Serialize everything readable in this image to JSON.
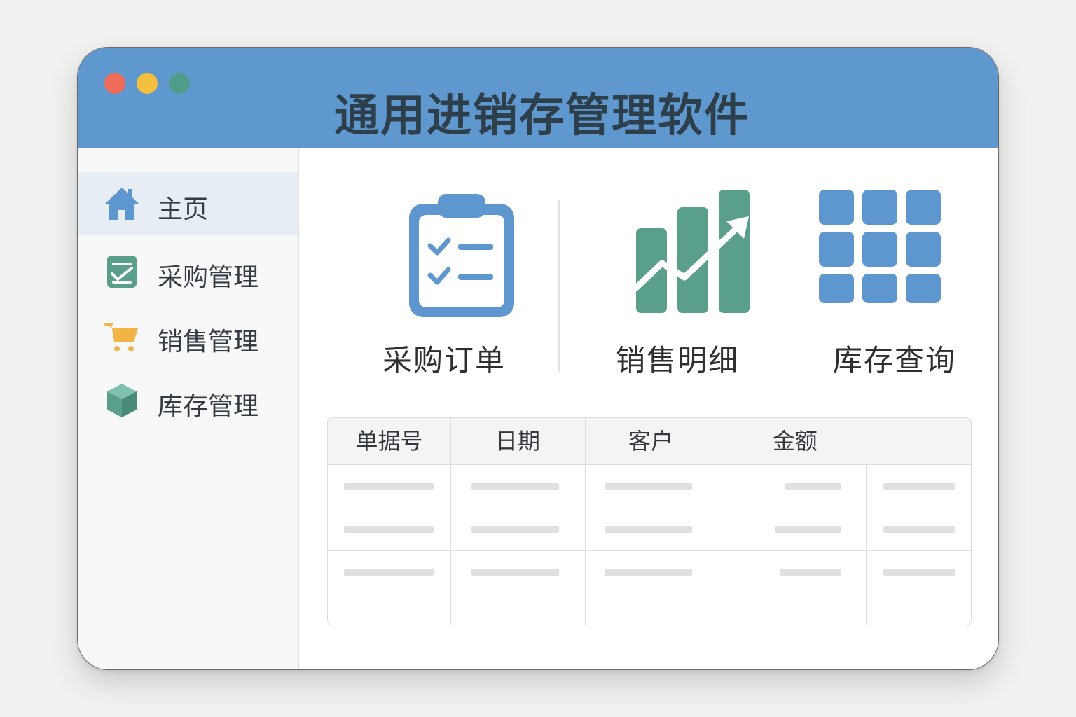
{
  "window": {
    "title": "通用进销存管理软件",
    "controls": [
      "close",
      "minimize",
      "maximize"
    ]
  },
  "sidebar": {
    "items": [
      {
        "label": "主页",
        "icon": "home-icon",
        "active": true
      },
      {
        "label": "采购管理",
        "icon": "clipboard-check-icon",
        "active": false
      },
      {
        "label": "销售管理",
        "icon": "cart-icon",
        "active": false
      },
      {
        "label": "库存管理",
        "icon": "box-icon",
        "active": false
      }
    ]
  },
  "tiles": [
    {
      "label": "采购订单",
      "icon": "clipboard-checklist-icon"
    },
    {
      "label": "销售明细",
      "icon": "growth-chart-icon"
    },
    {
      "label": "库存查询",
      "icon": "grid-icon"
    }
  ],
  "table": {
    "columns": [
      "单据号",
      "日期",
      "客户",
      "金额"
    ],
    "rows": 4,
    "cells": "placeholder"
  },
  "colors": {
    "titlebar": "#5f98cf",
    "accent_blue": "#5e96cf",
    "accent_green": "#5a9e8c",
    "accent_orange": "#f2b347",
    "sidebar_active": "#e6edf5"
  }
}
